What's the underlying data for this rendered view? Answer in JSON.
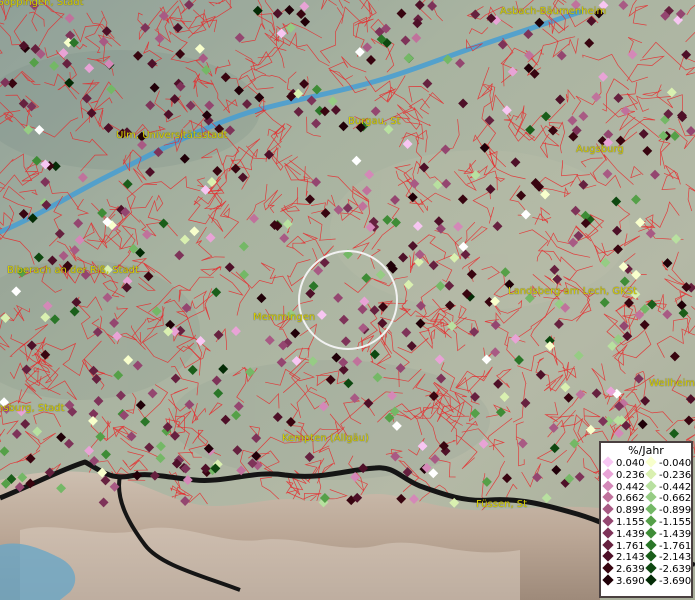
{
  "map": {
    "place_labels": [
      {
        "id": "goeppingen",
        "text": "Göppingen, Stadt"
      },
      {
        "id": "asbach",
        "text": "Asbach-Bäumenheim"
      },
      {
        "id": "ulm",
        "text": "Ulm, Universitätsstadt"
      },
      {
        "id": "burgau",
        "text": "Burgau, St"
      },
      {
        "id": "augsburg",
        "text": "Augsburg"
      },
      {
        "id": "biberach",
        "text": "Biberach an der Riß, Stadt"
      },
      {
        "id": "landsberg",
        "text": "Landsberg am Lech, GKSt"
      },
      {
        "id": "memmingen",
        "text": "Memmingen"
      },
      {
        "id": "weilheim",
        "text": "Weilheim"
      },
      {
        "id": "ravensburg",
        "text": "nsburg, Stadt"
      },
      {
        "id": "kempten",
        "text": "Kempten (Allgäu)"
      },
      {
        "id": "fuessen",
        "text": "Füssen, St"
      }
    ],
    "colors": {
      "boundary_lines": "#e8282a",
      "river": "#4a9fd0",
      "mountains": "#c4b4a4",
      "country_border": "#111111",
      "place_label": "#d8d000",
      "background": "#a3b19e"
    }
  },
  "legend": {
    "title": "%/Jahr",
    "positive": [
      {
        "label": "0.040",
        "color": "#f7c6f2"
      },
      {
        "label": "0.236",
        "color": "#e8a3d6"
      },
      {
        "label": "0.442",
        "color": "#d488b8"
      },
      {
        "label": "0.662",
        "color": "#c0729c"
      },
      {
        "label": "0.899",
        "color": "#a85a84"
      },
      {
        "label": "1.155",
        "color": "#944670"
      },
      {
        "label": "1.439",
        "color": "#7e3359"
      },
      {
        "label": "1.761",
        "color": "#66213f"
      },
      {
        "label": "2.143",
        "color": "#4e1028"
      },
      {
        "label": "2.639",
        "color": "#380510"
      },
      {
        "label": "3.690",
        "color": "#200008"
      }
    ],
    "negative": [
      {
        "label": "-0.040",
        "color": "#f8ffcc"
      },
      {
        "label": "-0.236",
        "color": "#d9f0b0"
      },
      {
        "label": "-0.442",
        "color": "#b8e0a0"
      },
      {
        "label": "-0.662",
        "color": "#96cc84"
      },
      {
        "label": "-0.899",
        "color": "#74b866"
      },
      {
        "label": "-1.155",
        "color": "#55a048"
      },
      {
        "label": "-1.439",
        "color": "#3e8c36"
      },
      {
        "label": "-1.761",
        "color": "#2a7628"
      },
      {
        "label": "-2.143",
        "color": "#1a5e1a"
      },
      {
        "label": "-2.639",
        "color": "#0e4810"
      },
      {
        "label": "-3.690",
        "color": "#042c06"
      }
    ]
  }
}
